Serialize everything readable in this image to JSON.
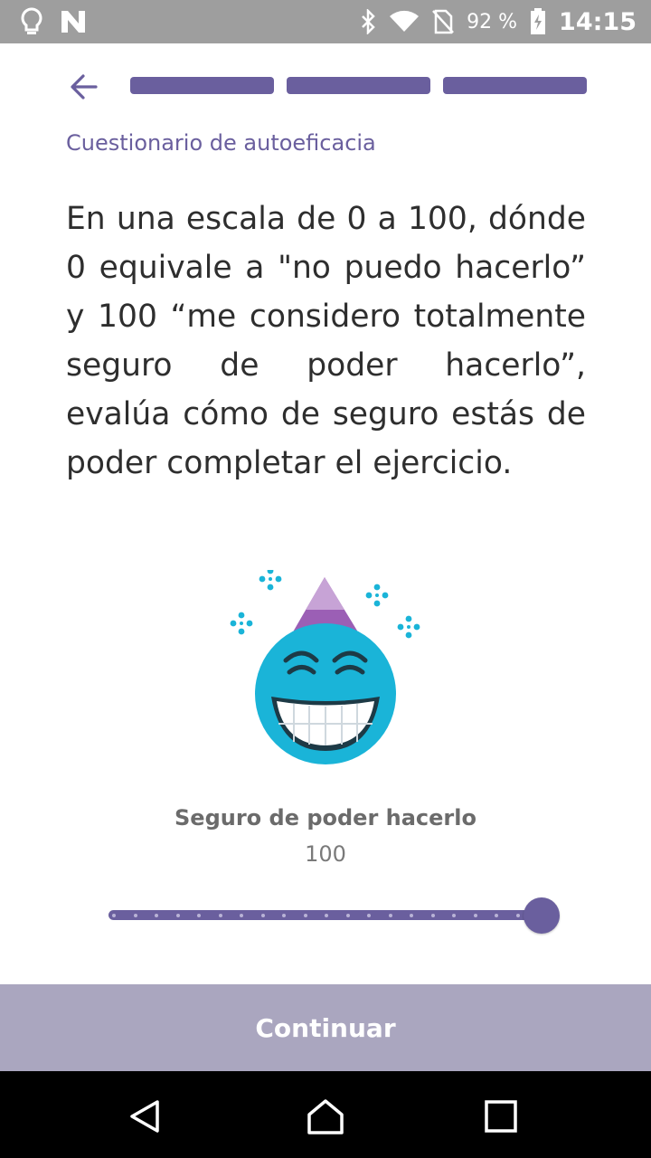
{
  "status_bar": {
    "battery": "92 %",
    "time": "14:15",
    "icons": [
      "lightbulb-icon",
      "n-icon",
      "bluetooth-icon",
      "wifi-icon",
      "no-sim-icon",
      "battery-icon"
    ]
  },
  "header": {
    "back_icon": "arrow-left-icon",
    "progress_segments": 3,
    "progress_color": "#6a5f9e"
  },
  "subtitle": "Cuestionario de autoeficacia",
  "question": "En una escala de 0 a 100, dónde 0 equivale a \"no puedo hacerlo” y 100 “me considero totalmente seguro de poder hacerlo”, evalúa cómo de seguro estás de poder completar el ejercicio.",
  "illustration": "party-face-emoji",
  "scale": {
    "label": "Seguro de poder hacerlo",
    "value": "100",
    "min": 0,
    "max": 100,
    "current": 100
  },
  "continue_button": "Continuar",
  "colors": {
    "accent": "#6a5f9e",
    "button_disabled": "#aaa6bf",
    "emoji_face": "#1ab4d8",
    "hat": "#9b5fb5"
  },
  "nav_bar": {
    "icons": [
      "back-triangle-icon",
      "home-icon",
      "recents-icon"
    ]
  }
}
